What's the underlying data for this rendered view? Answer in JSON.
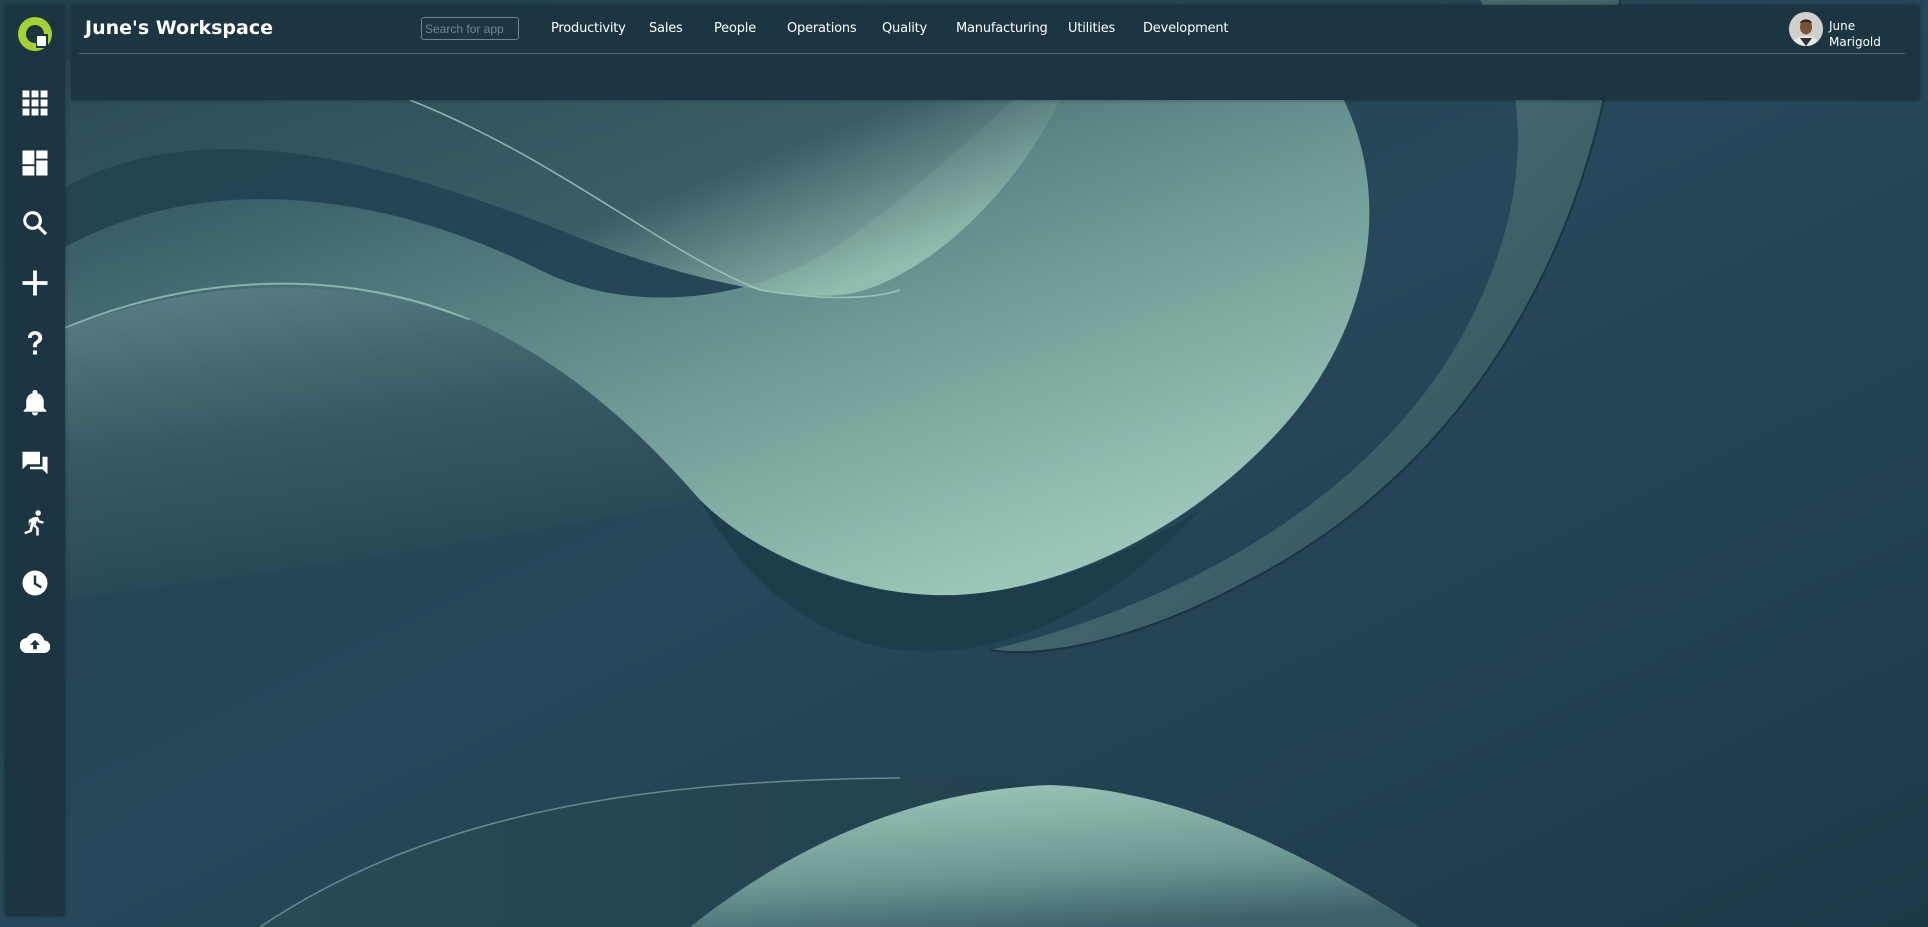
{
  "app": {
    "workspace_title": "June's Workspace"
  },
  "search": {
    "placeholder": "Search for app",
    "value": ""
  },
  "nav": {
    "items": [
      {
        "label": "Productivity"
      },
      {
        "label": "Sales"
      },
      {
        "label": "People"
      },
      {
        "label": "Operations"
      },
      {
        "label": "Quality"
      },
      {
        "label": "Manufacturing"
      },
      {
        "label": "Utilities"
      },
      {
        "label": "Development"
      }
    ]
  },
  "user": {
    "first_name": "June",
    "last_name": "Marigold"
  },
  "sidebar": {
    "icons": [
      {
        "icon": "apps-grid-icon"
      },
      {
        "icon": "dashboard-icon"
      },
      {
        "icon": "search-icon"
      },
      {
        "icon": "plus-icon"
      },
      {
        "icon": "help-icon"
      },
      {
        "icon": "bell-icon"
      },
      {
        "icon": "chat-icon"
      },
      {
        "icon": "running-person-icon"
      },
      {
        "icon": "clock-icon"
      },
      {
        "icon": "cloud-upload-icon"
      }
    ]
  },
  "colors": {
    "panel": "#1b3543",
    "background": "#1d3a48",
    "accent": "#a4d233",
    "text": "#ffffff"
  }
}
